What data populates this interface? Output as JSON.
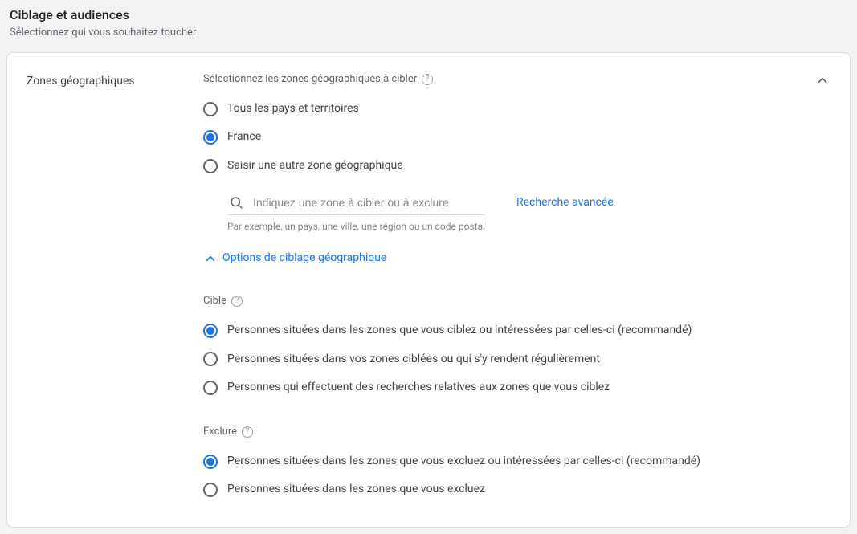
{
  "header": {
    "title": "Ciblage et audiences",
    "subtitle": "Sélectionnez qui vous souhaitez toucher"
  },
  "card": {
    "left_label": "Zones géographiques",
    "select_zones_label": "Sélectionnez les zones géographiques à cibler",
    "location_options": [
      {
        "label": "Tous les pays et territoires",
        "selected": false
      },
      {
        "label": "France",
        "selected": true
      },
      {
        "label": "Saisir une autre zone géographique",
        "selected": false
      }
    ],
    "search": {
      "placeholder": "Indiquez une zone à cibler ou à exclure",
      "hint": "Par exemple, un pays, une ville, une région ou un code postal",
      "advanced_label": "Recherche avancée"
    },
    "options_link": "Options de ciblage géographique",
    "target": {
      "label": "Cible",
      "options": [
        {
          "label": "Personnes situées dans les zones que vous ciblez ou intéressées par celles-ci (recommandé)",
          "selected": true
        },
        {
          "label": "Personnes situées dans vos zones ciblées ou qui s'y rendent régulièrement",
          "selected": false
        },
        {
          "label": "Personnes qui effectuent des recherches relatives aux zones que vous ciblez",
          "selected": false
        }
      ]
    },
    "exclude": {
      "label": "Exclure",
      "options": [
        {
          "label": "Personnes situées dans les zones que vous excluez ou intéressées par celles-ci (recommandé)",
          "selected": true
        },
        {
          "label": "Personnes situées dans les zones que vous excluez",
          "selected": false
        }
      ]
    }
  }
}
